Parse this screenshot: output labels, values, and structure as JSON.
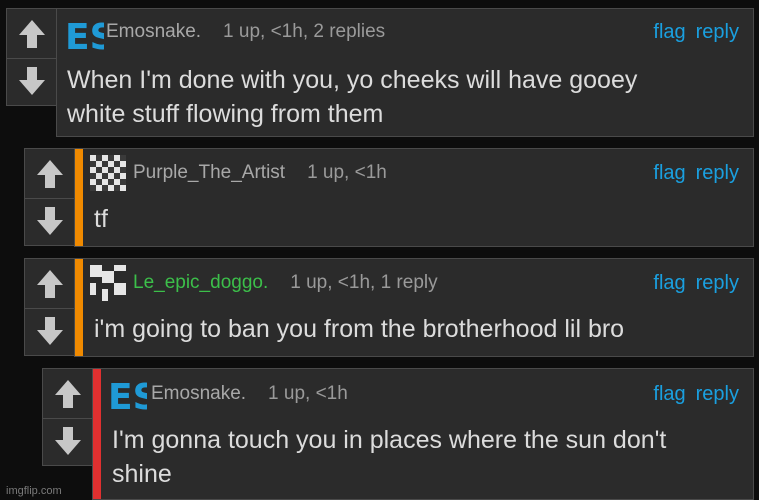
{
  "actions": {
    "flag": "flag",
    "reply": "reply"
  },
  "comments": [
    {
      "username": "Emosnake.",
      "avatar_text": "ES",
      "meta": "1 up, <1h, 2 replies",
      "text": "When I'm done with you, yo cheeks will have gooey\nwhite stuff flowing from them",
      "stripe_color": ""
    },
    {
      "username": "Purple_The_Artist",
      "meta": "1 up, <1h",
      "text": "tf",
      "stripe_color": "#f08a00"
    },
    {
      "username": "Le_epic_doggo.",
      "meta": "1 up, <1h, 1 reply",
      "text": "i'm going to ban you from the brotherhood lil bro",
      "stripe_color": "#f08a00",
      "username_color": "#3cbf4a"
    },
    {
      "username": "Emosnake.",
      "avatar_text": "ES",
      "meta": "1 up, <1h",
      "text": "I'm gonna touch you in places where the sun don't\nshine",
      "stripe_color": "#e03030"
    }
  ],
  "watermark": "imgflip.com",
  "colors": {
    "link": "#1aa0e0",
    "emosnake_logo": "#1f9ad6",
    "background": "#0d0d0d",
    "panel": "#2b2b2b"
  }
}
